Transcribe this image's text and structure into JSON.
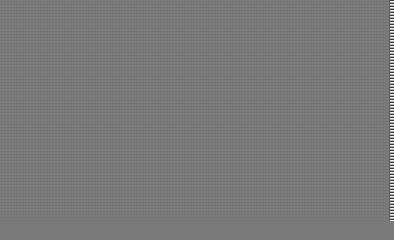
{
  "screen": {
    "background_color": "#7a7a7a",
    "edge_color": "#8c8c8c"
  }
}
